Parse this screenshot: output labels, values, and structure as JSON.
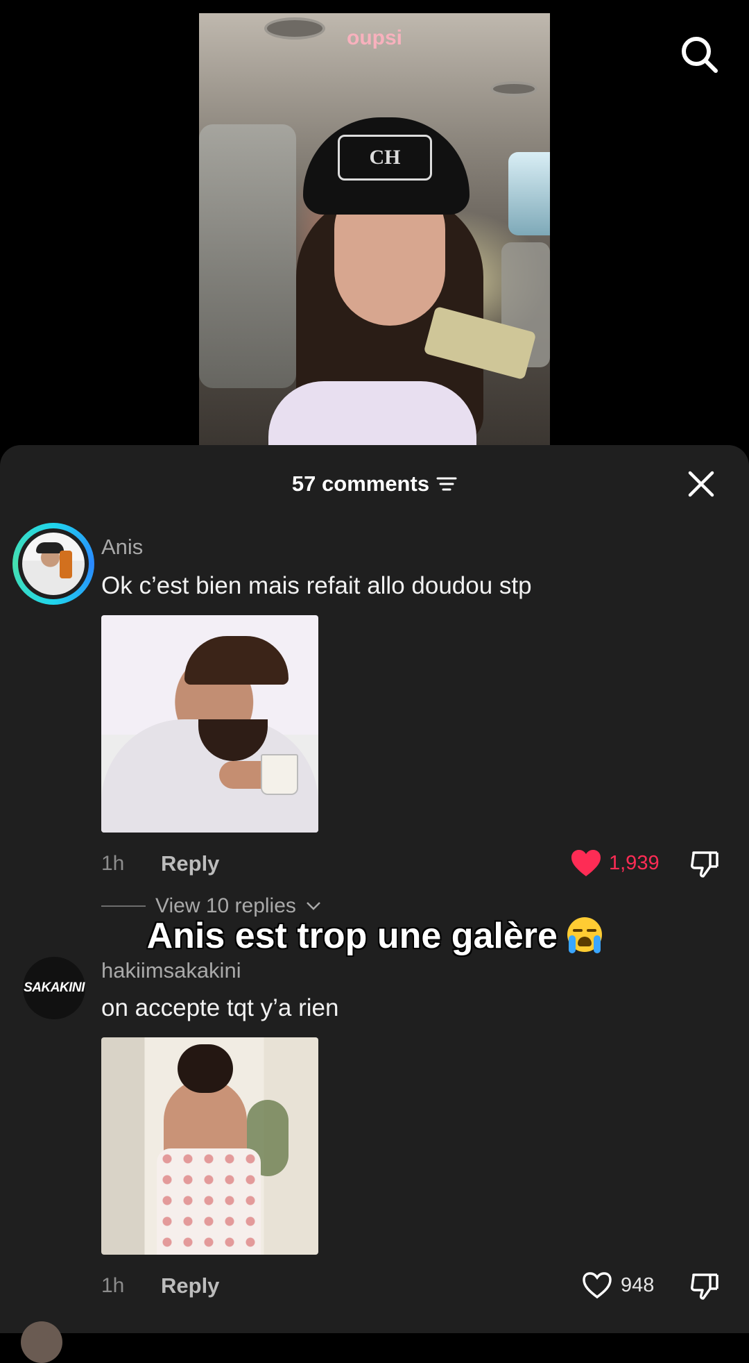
{
  "video": {
    "title": "oupsi"
  },
  "header": {
    "comments_label": "57 comments"
  },
  "icons": {
    "search": "search-icon",
    "close": "close-icon",
    "filter": "sort-filter-icon",
    "heart_filled": "heart-filled-icon",
    "heart_outline": "heart-outline-icon",
    "dislike": "dislike-icon",
    "chevron": "chevron-down-icon"
  },
  "colors": {
    "heart_liked": "#fe2c55",
    "sheet_bg": "#1f1f1f",
    "title_pink": "#f8b1bd"
  },
  "comments": [
    {
      "username": "Anis",
      "text": "Ok c’est bien mais refait allo doudou stp",
      "time": "1h",
      "reply_label": "Reply",
      "likes": "1,939",
      "liked": true,
      "view_replies": "View 10 replies"
    },
    {
      "username": "hakiimsakakini",
      "avatar_text": "SAKAKINI",
      "text": "on accepte tqt y’a rien",
      "time": "1h",
      "reply_label": "Reply",
      "likes": "948",
      "liked": false
    }
  ],
  "overlay": {
    "caption": "Anis est trop une galère"
  }
}
